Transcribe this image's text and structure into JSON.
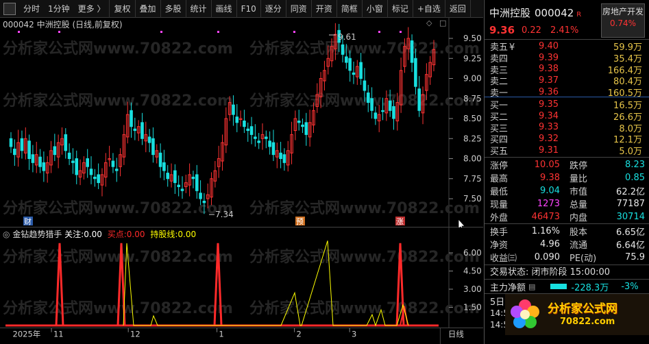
{
  "toolbar": {
    "items": [
      "分时",
      "1分钟",
      "更多 〉",
      "复权",
      "叠加",
      "多股",
      "统计",
      "画线",
      "F10",
      "逐分",
      "同资",
      "开资",
      "简框",
      "小窗",
      "标记",
      "+自选",
      "返回"
    ]
  },
  "chart": {
    "title": "000042 中洲控股 (日线,前复权)",
    "price_ticks": [
      "9.50",
      "9.25",
      "9.00",
      "8.75",
      "8.50",
      "8.25",
      "8.00",
      "7.75",
      "7.50"
    ],
    "max_label": "9.61",
    "min_label": "7.34",
    "markers": [
      "财",
      "预",
      "涨"
    ],
    "colors": {
      "up": "#ff3333",
      "down": "#18e0e0",
      "bg": "#000000"
    }
  },
  "watermarks": [
    "分析家公式网www.70822.com",
    "分析家公式网www.70822.com"
  ],
  "indicator": {
    "name": "金钻趋势猎手",
    "watch_label": "关注:",
    "watch_value": "0.00",
    "buy_label": "买点:",
    "buy_value": "0.00",
    "hold_label": "持股线:",
    "hold_value": "0.00",
    "ticks": [
      "6.00",
      "4.50",
      "3.00",
      "1.50"
    ],
    "colors": {
      "watch": "#ffffff",
      "buy": "#ff2a2a",
      "hold": "#ffff00"
    }
  },
  "date_axis": {
    "labels": [
      "2025年",
      "11",
      "12",
      "1",
      "2",
      "3"
    ],
    "period": "日线"
  },
  "quote": {
    "name": "中洲控股",
    "code": "000042",
    "badge": "R",
    "last": "9.36",
    "change": "0.22",
    "change_pct": "2.41%",
    "sector": "房地产开发",
    "sector_pct": "0.74%",
    "asks": [
      {
        "label": "卖五",
        "price": "9.40",
        "vol": "59.9万",
        "mark": "¥"
      },
      {
        "label": "卖四",
        "price": "9.39",
        "vol": "35.4万",
        "mark": ""
      },
      {
        "label": "卖三",
        "price": "9.38",
        "vol": "166.4万",
        "mark": ""
      },
      {
        "label": "卖二",
        "price": "9.37",
        "vol": "80.4万",
        "mark": ""
      },
      {
        "label": "卖一",
        "price": "9.36",
        "vol": "160.5万",
        "mark": ""
      }
    ],
    "bids": [
      {
        "label": "买一",
        "price": "9.35",
        "vol": "16.5万"
      },
      {
        "label": "买二",
        "price": "9.34",
        "vol": "26.6万"
      },
      {
        "label": "买三",
        "price": "9.33",
        "vol": "8.0万"
      },
      {
        "label": "买四",
        "price": "9.32",
        "vol": "12.1万"
      },
      {
        "label": "买五",
        "price": "9.31",
        "vol": "5.0万"
      }
    ],
    "stats": [
      {
        "k1": "涨停",
        "v1": "10.05",
        "c1": "red",
        "k2": "跌停",
        "v2": "8.23",
        "c2": "green"
      },
      {
        "k1": "最高",
        "v1": "9.38",
        "c1": "red",
        "k2": "量比",
        "v2": "0.85",
        "c2": "green"
      },
      {
        "k1": "最低",
        "v1": "9.04",
        "c1": "green",
        "k2": "市值",
        "v2": "62.2亿",
        "c2": "white"
      },
      {
        "k1": "现量",
        "v1": "1273",
        "c1": "mag",
        "k2": "总量",
        "v2": "77187",
        "c2": "white"
      },
      {
        "k1": "外盘",
        "v1": "46473",
        "c1": "red",
        "k2": "内盘",
        "v2": "30714",
        "c2": "green"
      }
    ],
    "stats2": [
      {
        "k1": "换手",
        "v1": "1.16%",
        "k2": "股本",
        "v2": "6.65亿"
      },
      {
        "k1": "净资",
        "v1": "4.96",
        "k2": "流通",
        "v2": "6.64亿"
      },
      {
        "k1": "收益㈢",
        "v1": "0.090",
        "k2": "PE(动)",
        "v2": "75.9"
      }
    ],
    "status": "交易状态: 闭市阶段 15:00:00",
    "flow_label": "主力净额",
    "flow_value": "-228.3万",
    "flow_pct": "-3%",
    "day_label": "5日",
    "time_rows": [
      "14:5",
      "14:5"
    ]
  },
  "logo": {
    "title": "分析家公式网",
    "url": "70822.com"
  }
}
